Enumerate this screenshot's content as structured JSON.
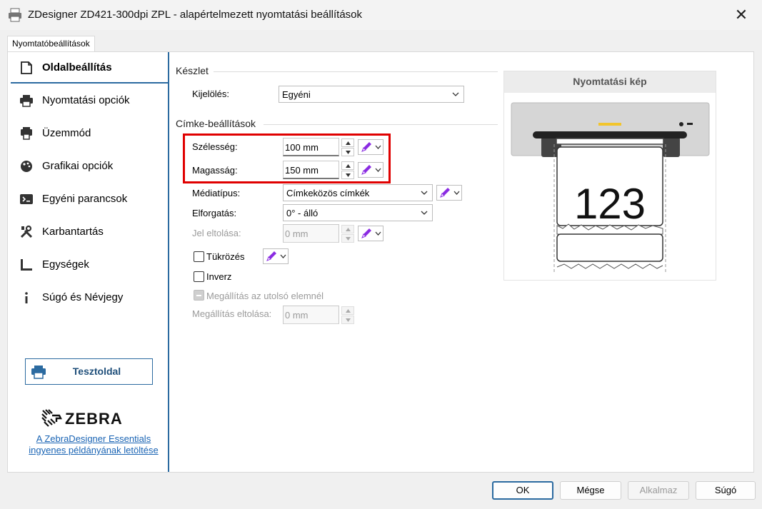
{
  "window": {
    "title": "ZDesigner ZD421-300dpi ZPL - alapértelmezett nyomtatási beállítások",
    "close_glyph": "✕",
    "printer_icon": "printer-icon"
  },
  "tab": {
    "label": "Nyomtatóbeállítások"
  },
  "sidebar": {
    "items": [
      {
        "label": "Oldalbeállítás",
        "icon": "page-icon",
        "active": true
      },
      {
        "label": "Nyomtatási opciók",
        "icon": "printer-icon"
      },
      {
        "label": "Üzemmód",
        "icon": "printer-mode-icon"
      },
      {
        "label": "Grafikai opciók",
        "icon": "palette-icon"
      },
      {
        "label": "Egyéni parancsok",
        "icon": "terminal-icon"
      },
      {
        "label": "Karbantartás",
        "icon": "tools-icon"
      },
      {
        "label": "Egységek",
        "icon": "ruler-icon"
      },
      {
        "label": "Súgó és Névjegy",
        "icon": "info-icon"
      }
    ],
    "test_button": "Tesztoldal",
    "logo_text": "ZEBRA",
    "download_link": "A ZebraDesigner Essentials ingyenes példányának letöltése"
  },
  "stock": {
    "group_title": "Készlet",
    "selection_label": "Kijelölés:",
    "selection_value": "Egyéni"
  },
  "label_settings": {
    "group_title": "Címke-beállítások",
    "width_label": "Szélesség:",
    "width_value": "100 mm",
    "height_label": "Magasság:",
    "height_value": "150 mm",
    "media_type_label": "Médiatípus:",
    "media_type_value": "Címkeközös címkék",
    "rotation_label": "Elforgatás:",
    "rotation_value": "0° - álló",
    "mark_offset_label": "Jel eltolása:",
    "mark_offset_value": "0 mm",
    "mirror_label": "Tükrözés",
    "inverse_label": "Inverz",
    "stop_last_label": "Megállítás az utolsó elemnél",
    "stop_offset_label": "Megállítás eltolása:",
    "stop_offset_value": "0 mm"
  },
  "preview": {
    "title": "Nyomtatási kép",
    "sample_text": "123"
  },
  "footer": {
    "ok": "OK",
    "cancel": "Mégse",
    "apply": "Alkalmaz",
    "help": "Súgó"
  },
  "colors": {
    "accent": "#2b6aa0",
    "highlight": "#e00000",
    "pencil": "#8a2be2"
  }
}
